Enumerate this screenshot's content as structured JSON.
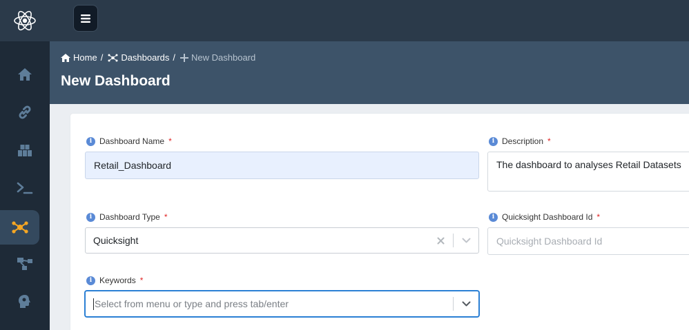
{
  "header": {
    "breadcrumb": {
      "home": "Home",
      "dashboards": "Dashboards",
      "current": "New Dashboard"
    },
    "title": "New Dashboard"
  },
  "sidebar": {
    "items": [
      {
        "icon": "home-icon"
      },
      {
        "icon": "link-icon"
      },
      {
        "icon": "datasets-icon"
      },
      {
        "icon": "terminal-icon"
      },
      {
        "icon": "dashboard-network-icon",
        "active": true
      },
      {
        "icon": "workflow-icon"
      },
      {
        "icon": "ml-head-icon"
      }
    ]
  },
  "form": {
    "dashboard_name": {
      "label": "Dashboard Name",
      "required": "*",
      "value": "Retail_Dashboard"
    },
    "description": {
      "label": "Description",
      "required": "*",
      "value": "The dashboard to analyses Retail Datasets"
    },
    "dashboard_type": {
      "label": "Dashboard Type",
      "required": "*",
      "value": "Quicksight"
    },
    "quicksight_id": {
      "label": "Quicksight Dashboard Id",
      "required": "*",
      "placeholder": "Quicksight Dashboard Id"
    },
    "keywords": {
      "label": "Keywords",
      "required": "*",
      "placeholder": "Select from menu or type and press tab/enter"
    }
  },
  "colors": {
    "accent": "#f5a623",
    "focus": "#2a7fd4",
    "sidebar_bg": "#1e2a37",
    "header_bg": "#3d5369"
  }
}
